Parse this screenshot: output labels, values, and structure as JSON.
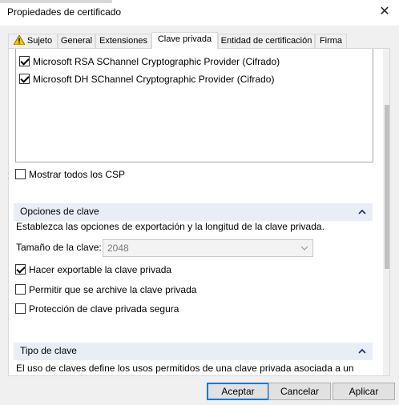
{
  "window": {
    "title": "Propiedades de certificado",
    "close_glyph": "✕"
  },
  "tabs": [
    {
      "label": "Sujeto",
      "icon": "warning-icon"
    },
    {
      "label": "General"
    },
    {
      "label": "Extensiones"
    },
    {
      "label": "Clave privada",
      "active": true
    },
    {
      "label": "Entidad de certificación"
    },
    {
      "label": "Firma"
    }
  ],
  "providers": [
    {
      "label": "Microsoft RSA SChannel Cryptographic Provider (Cifrado)",
      "checked": true
    },
    {
      "label": "Microsoft DH SChannel Cryptographic Provider (Cifrado)",
      "checked": true
    }
  ],
  "show_all_csp": {
    "label": "Mostrar todos los CSP",
    "checked": false
  },
  "key_options": {
    "heading": "Opciones de clave",
    "description": "Establezca las opciones de exportación y la longitud de la clave privada.",
    "key_size_label": "Tamaño de la clave:",
    "key_size_value": "2048",
    "exportable": {
      "label": "Hacer exportable la clave privada",
      "checked": true
    },
    "archive": {
      "label": "Permitir que se archive la clave privada",
      "checked": false
    },
    "strong_protection": {
      "label": "Protección de clave privada segura",
      "checked": false
    }
  },
  "key_type": {
    "heading": "Tipo de clave",
    "description": "El uso de claves define los usos permitidos de una clave privada asociada a un"
  },
  "buttons": {
    "ok": "Aceptar",
    "cancel": "Cancelar",
    "apply": "Aplicar"
  }
}
